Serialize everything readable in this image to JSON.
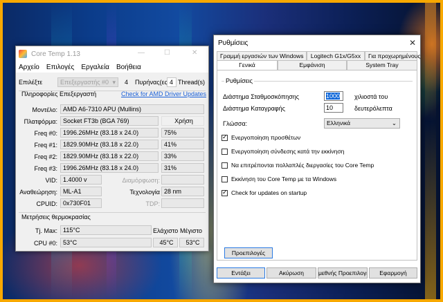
{
  "coretemp": {
    "title": "Core Temp 1.13",
    "controls": {
      "minimize": "—",
      "maximize": "☐",
      "close": "✕"
    },
    "menu": [
      "Αρχείο",
      "Επιλογές",
      "Εργαλεία",
      "Βοήθεια"
    ],
    "select_label": "Επιλέξτε",
    "processor_select": "Επεξεργαστής #0",
    "cores_value": "4",
    "cores_label": "Πυρήνας(ες)",
    "threads_value": "4",
    "threads_label": "Thread(s)",
    "proc_info_title": "Πληροφορίες Επεξεργαστή",
    "driver_link": "Check for AMD Driver Updates",
    "model_label": "Μοντέλο:",
    "model_value": "AMD A6-7310 APU (Mullins)",
    "platform_label": "Πλατφόρμα:",
    "platform_value": "Socket FT3b (BGA 769)",
    "usage_header": "Χρήση",
    "freqs": [
      {
        "label": "Freq #0:",
        "value": "1996.26MHz (83.18 x 24.0)",
        "usage": "75%"
      },
      {
        "label": "Freq #1:",
        "value": "1829.90MHz (83.18 x 22.0)",
        "usage": "41%"
      },
      {
        "label": "Freq #2:",
        "value": "1829.90MHz (83.18 x 22.0)",
        "usage": "33%"
      },
      {
        "label": "Freq #3:",
        "value": "1996.26MHz (83.18 x 24.0)",
        "usage": "31%"
      }
    ],
    "vid_label": "VID:",
    "vid_value": "1.4000 v",
    "modulation_label": "Διαμόρφωση:",
    "revision_label": "Αναθεώρηση:",
    "revision_value": "ML-A1",
    "tech_label": "Τεχνολογία",
    "tech_value": "28 nm",
    "cpuid_label": "CPUID:",
    "cpuid_value": "0x730F01",
    "tdp_label": "TDP:",
    "temp_title": "Μετρήσεις θερμοκρασίας",
    "tjmax_label": "Tj. Max:",
    "tjmax_value": "115°C",
    "min_header": "Ελάχιστο",
    "max_header": "Μέγιστο",
    "cpu0_label": "CPU #0:",
    "cpu0_value": "53°C",
    "cpu0_min": "45°C",
    "cpu0_max": "53°C"
  },
  "settings": {
    "title": "Ρυθμίσεις",
    "close": "✕",
    "tabs_row1": [
      "Γραμμή εργασιών των Windows",
      "Logitech G1x/G5xx",
      "Για προχωρημένους"
    ],
    "tabs_row2": [
      "Γενικά",
      "Εμφάνιση",
      "System Tray"
    ],
    "group_title": "Ρυθμίσεις",
    "polling_label": "Διάστημα Σταθμοσκόπησης",
    "polling_value": "1000",
    "polling_unit": "χιλιοστά του",
    "logging_label": "Διάστημα Καταγραφής",
    "logging_value": "10",
    "logging_unit": "δευτερόλεπτα",
    "language_label": "Γλώσσα:",
    "language_value": "Ελληνικά",
    "checkboxes": [
      {
        "label": "Ενεργοποίηση προσθέτων",
        "checked": true
      },
      {
        "label": "Ενεργοποίηση σύνδεσης κατά την εκκίνηση",
        "checked": false
      },
      {
        "label": "Να επιτρέπονται πολλαπλές διεργασίες του Core Temp",
        "checked": false
      },
      {
        "label": "Εκκίνηση του Core Temp με τα Windows",
        "checked": false
      },
      {
        "label": "Check for updates on startup",
        "checked": true
      }
    ],
    "defaults_button": "Προεπιλογές",
    "buttons": [
      "Εντάξει",
      "Ακύρωση",
      "μεθνής Προεπιλογέ",
      "Εφαρμογή"
    ]
  }
}
